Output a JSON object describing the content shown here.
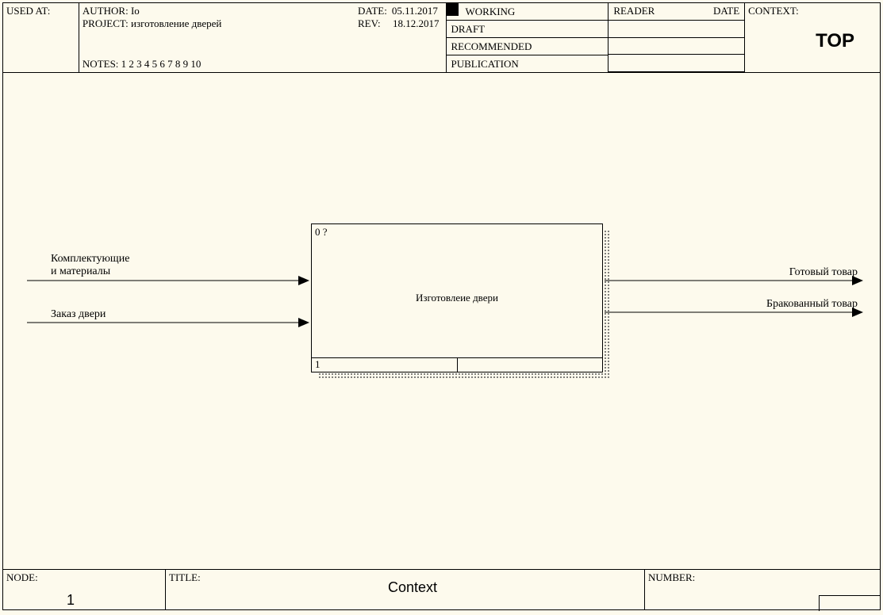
{
  "header": {
    "used_at_label": "USED AT:",
    "author_label": "AUTHOR:",
    "author": "Io",
    "project_label": "PROJECT:",
    "project": "изготовление дверей",
    "date_label": "DATE:",
    "date": "05.11.2017",
    "rev_label": "REV:",
    "rev": "18.12.2017",
    "notes_label": "NOTES:",
    "notes": "1  2  3  4  5  6  7  8  9  10",
    "status": {
      "working": "WORKING",
      "draft": "DRAFT",
      "recommended": "RECOMMENDED",
      "publication": "PUBLICATION"
    },
    "reader_label": "READER",
    "reader_date_label": "DATE",
    "context_label": "CONTEXT:",
    "context_value": "TOP"
  },
  "diagram": {
    "box": {
      "top_code": "0 ?",
      "title": "Изготовлеие двери",
      "bottom_left": "1",
      "bottom_right": ""
    },
    "arrows": {
      "input1": "Комплектующие\nи материалы",
      "input2": "Заказ двери",
      "output1": "Готовый товар",
      "output2": "Бракованный товар"
    }
  },
  "footer": {
    "node_label": "NODE:",
    "node_value": "1",
    "title_label": "TITLE:",
    "title_value": "Context",
    "number_label": "NUMBER:"
  }
}
